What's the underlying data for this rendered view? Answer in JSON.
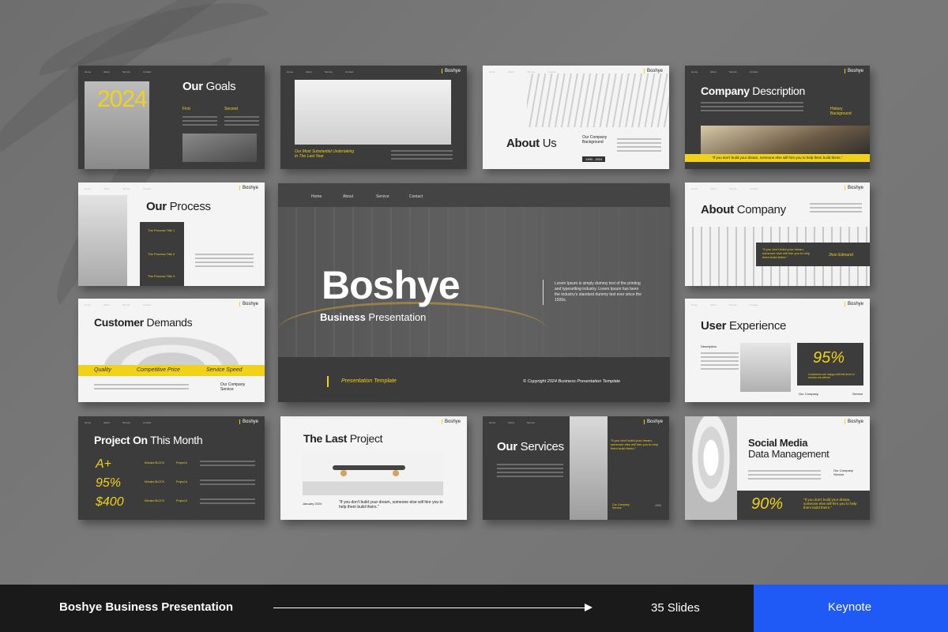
{
  "nav": [
    "Home",
    "About",
    "Service",
    "Contact"
  ],
  "brand": "Boshye",
  "slides": {
    "goals": {
      "year": "2024",
      "title_b": "Our",
      "title_n": " Goals",
      "col1": "First",
      "col2": "Second"
    },
    "hall": {
      "caption": "Our Most Substantial Undertaking In The Last Year"
    },
    "about_us": {
      "title_b": "About",
      "title_n": " Us",
      "sub": "Our Company Background",
      "pill": "1990 - 2024"
    },
    "company_desc": {
      "title_b": "Company",
      "title_n": " Description",
      "side": "History Background",
      "quote": "\"If you don't build your dream, someone else will hire you to help them build theirs.\""
    },
    "process": {
      "title_b": "Our",
      "title_n": " Process",
      "steps": [
        "The Process Title 1",
        "The Process Title 2",
        "The Process Title 3"
      ]
    },
    "about_company": {
      "title_b": "About",
      "title_n": " Company",
      "quote": "\"If you don't build your dream, someone else will hire you to help them build theirs.\"",
      "author": "Jhon Edmund"
    },
    "customer": {
      "title_b": "Customer",
      "title_n": " Demands",
      "band": [
        "Quality",
        "Competitive Price",
        "Service Speed"
      ],
      "sub": "Our Company Service"
    },
    "ux": {
      "title_b": "User",
      "title_n": " Experience",
      "desc": "Description",
      "pct": "95%",
      "pct_text": "Customers are happy with the level of service we deliver",
      "cap1": "Our Company",
      "cap2": "Service"
    },
    "project_month": {
      "title_b": "Project On",
      "title_n": " This Month",
      "rows": [
        {
          "v": "A+",
          "m": "Minutes BLOCK",
          "p": "Project A"
        },
        {
          "v": "95%",
          "m": "Minutes BLOCK",
          "p": "Project A"
        },
        {
          "v": "$400",
          "m": "Minutes BLOCK",
          "p": "Project A"
        }
      ]
    },
    "last_project": {
      "title_b": "The Last",
      "title_n": " Project",
      "date": "January 2024",
      "quote": "\"If you don't build your dream, someone else will hire you to help them build theirs.\""
    },
    "services": {
      "title_b": "Our",
      "title_n": " Services",
      "quote": "\"If you don't build your dream, someone else will hire you to help them build theirs.\"",
      "label": "Our Company Service",
      "year": "1990"
    },
    "social": {
      "title_b": "Social Media",
      "title_n": "Data Management",
      "sub": "Our Company Service",
      "pct": "90%",
      "quote": "\"If you don't build your dream, someone else will hire you to help them build theirs.\""
    }
  },
  "main": {
    "title": "Boshye",
    "subtitle_b": "Business",
    "subtitle_n": " Presentation",
    "body": "Lorem Ipsum is simply dummy text of the printing and typesetting industry. Lorem Ipsum has been the industry's standard dummy text ever since the 1500s.",
    "template": "Presentation Template",
    "copyright": "© Copyright 2024 Business Presentation Template"
  },
  "footer": {
    "title": "Boshye Business Presentation",
    "slides": "35 Slides",
    "app": "Keynote"
  },
  "colors": {
    "accent": "#f1d21a",
    "dark": "#3c3c3c",
    "footer": "#1a1a1a",
    "button": "#1f5af6"
  }
}
